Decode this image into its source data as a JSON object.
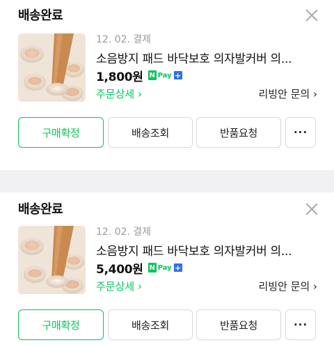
{
  "orders": [
    {
      "status": "배송완료",
      "date": "12. 02. 결제",
      "title": "소음방지 패드 바닥보호 의자발커버 의...",
      "price": "1,800원",
      "pay_badge": {
        "n": "N",
        "pay": "Pay",
        "plus": "+"
      },
      "detail_link": "주문상세 ›",
      "inquiry_link": "리빙안 문의 ›",
      "buttons": {
        "confirm": "구매확정",
        "track": "배송조회",
        "return": "반품요청",
        "more": "···"
      }
    },
    {
      "status": "배송완료",
      "date": "12. 02. 결제",
      "title": "소음방지 패드 바닥보호 의자발커버 의...",
      "price": "5,400원",
      "pay_badge": {
        "n": "N",
        "pay": "Pay",
        "plus": "+"
      },
      "detail_link": "주문상세 ›",
      "inquiry_link": "리빙안 문의 ›",
      "buttons": {
        "confirm": "구매확정",
        "track": "배송조회",
        "return": "반품요청",
        "more": "···"
      }
    }
  ],
  "colors": {
    "accent": "#03c75a",
    "npay_plus": "#2f6fea",
    "divider": "#f1f1f4"
  },
  "icons": {
    "close": "close-icon",
    "more": "more-icon"
  }
}
